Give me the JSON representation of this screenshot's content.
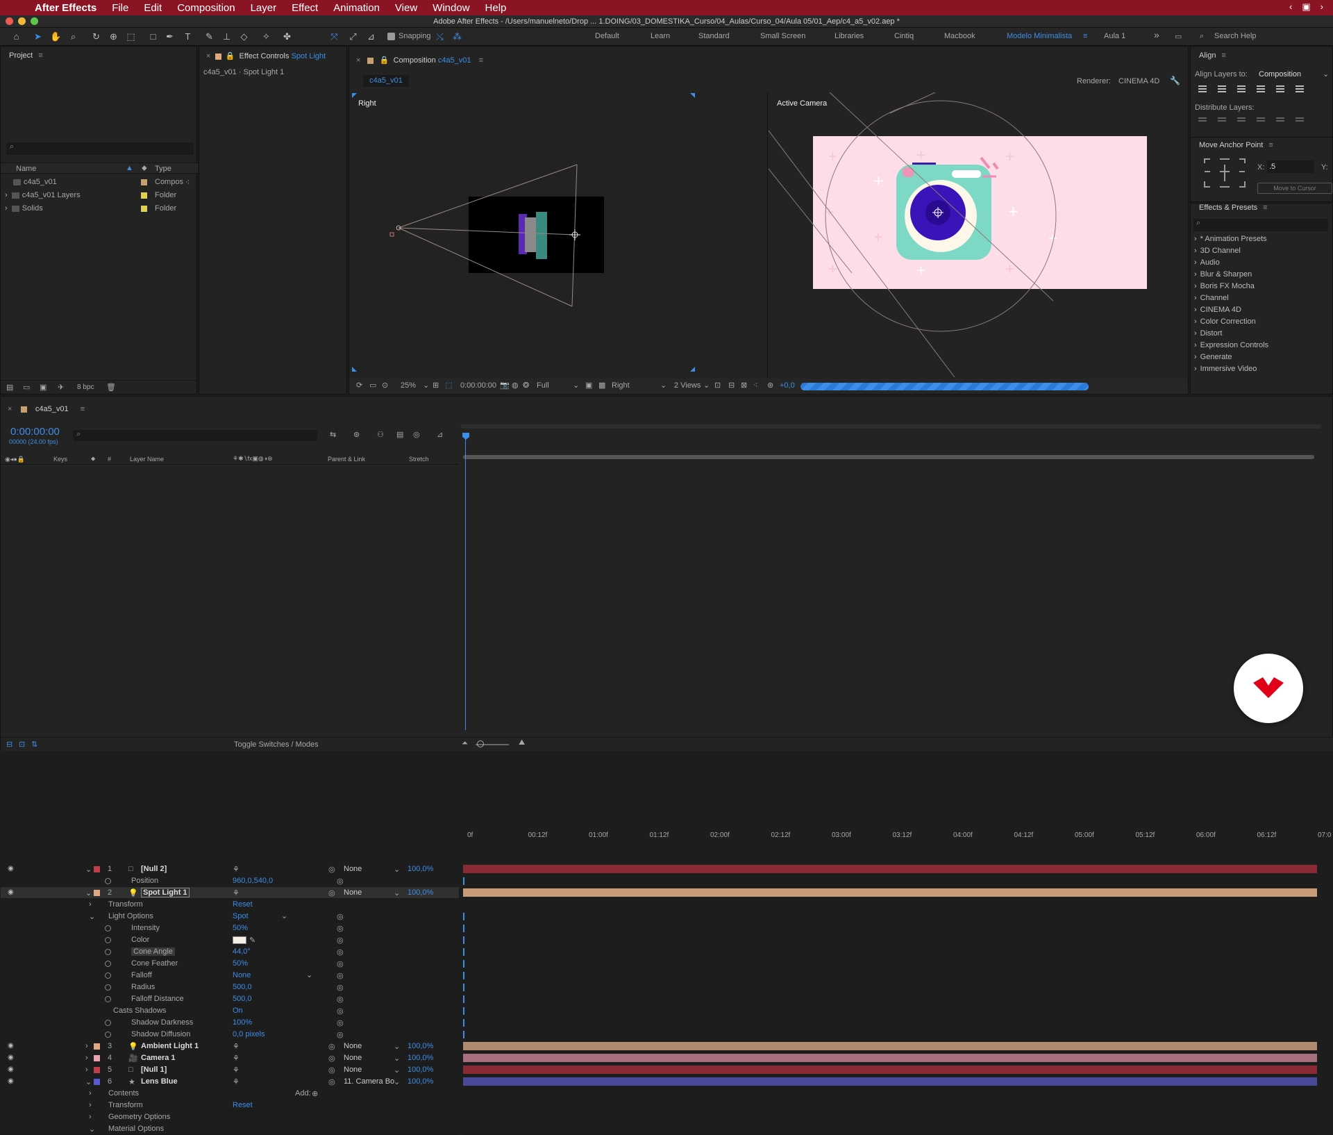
{
  "menubar": {
    "apple": "",
    "app": "After Effects",
    "items": [
      "File",
      "Edit",
      "Composition",
      "Layer",
      "Effect",
      "Animation",
      "View",
      "Window",
      "Help"
    ]
  },
  "titlebar": {
    "title": "Adobe After Effects - /Users/manuelneto/Drop ... 1.DOING/03_DOMESTIKA_Curso/04_Aulas/Curso_04/Aula 05/01_Aep/c4_a5_v02.aep *"
  },
  "toolbar": {
    "snapping": "Snapping",
    "workspaces": [
      "Default",
      "Learn",
      "Standard",
      "Small Screen",
      "Libraries",
      "Cintiq",
      "Macbook",
      "Modelo Minimalista",
      "Aula 1"
    ],
    "active_workspace": "Modelo Minimalista",
    "search_help": "Search Help"
  },
  "project": {
    "title": "Project",
    "search_placeholder": "",
    "col_name": "Name",
    "col_type": "Type",
    "items": [
      {
        "name": "c4a5_v01",
        "type": "Compos",
        "color": "#c8a070"
      },
      {
        "name": "c4a5_v01 Layers",
        "type": "Folder",
        "color": "#e0d050"
      },
      {
        "name": "Solids",
        "type": "Folder",
        "color": "#e0d050"
      }
    ],
    "bpc": "8 bpc"
  },
  "effect_controls": {
    "title": "Effect Controls",
    "layer": "Spot Light",
    "subtitle": "c4a5_v01 · Spot Light 1"
  },
  "composition": {
    "title": "Composition",
    "comp_name": "c4a5_v01",
    "tab": "c4a5_v01",
    "renderer_label": "Renderer:",
    "renderer": "CINEMA 4D",
    "view_left": "Right",
    "view_right": "Active Camera",
    "zoom": "25%",
    "timecode": "0:00:00:00",
    "resolution": "Full",
    "view_menu": "Right",
    "views": "2 Views",
    "exposure": "+0,0"
  },
  "align": {
    "title": "Align",
    "align_to_label": "Align Layers to:",
    "align_to": "Composition",
    "distribute": "Distribute Layers:"
  },
  "anchor": {
    "title": "Move Anchor Point",
    "x_label": "X:",
    "x_value": ".5",
    "y_label": "Y:",
    "move_btn": "Move to Cursor"
  },
  "effects_presets": {
    "title": "Effects & Presets",
    "items": [
      "* Animation Presets",
      "3D Channel",
      "Audio",
      "Blur & Sharpen",
      "Boris FX Mocha",
      "Channel",
      "CINEMA 4D",
      "Color Correction",
      "Distort",
      "Expression Controls",
      "Generate",
      "Immersive Video"
    ]
  },
  "timeline": {
    "comp_tab": "c4a5_v01",
    "timecode": "0:00:00:00",
    "fps": "00000 (24.00 fps)",
    "headers": {
      "keys": "Keys",
      "num": "#",
      "layer_name": "Layer Name",
      "parent": "Parent & Link",
      "stretch": "Stretch"
    },
    "ruler": [
      "0f",
      "00:12f",
      "01:00f",
      "01:12f",
      "02:00f",
      "02:12f",
      "03:00f",
      "03:12f",
      "04:00f",
      "04:12f",
      "05:00f",
      "05:12f",
      "06:00f",
      "06:12f",
      "07:0"
    ],
    "rows": [
      {
        "kind": "layer",
        "num": "1",
        "name": "[Null 2]",
        "color": "#c0404a",
        "parent": "None",
        "stretch": "100,0%",
        "bar": "#8a2a35"
      },
      {
        "kind": "prop",
        "indent": 2,
        "name": "Position",
        "value": "960,0,540,0"
      },
      {
        "kind": "layer",
        "num": "2",
        "name": "Spot Light 1",
        "color": "#e0a880",
        "parent": "None",
        "stretch": "100,0%",
        "bar": "#c79a78",
        "selected": true
      },
      {
        "kind": "group",
        "indent": 1,
        "name": "Transform",
        "value": "Reset"
      },
      {
        "kind": "group",
        "indent": 1,
        "name": "Light Options",
        "value": "Spot",
        "open": true
      },
      {
        "kind": "prop",
        "indent": 2,
        "name": "Intensity",
        "value": "50%"
      },
      {
        "kind": "prop",
        "indent": 2,
        "name": "Color",
        "value": ""
      },
      {
        "kind": "prop",
        "indent": 2,
        "name": "Cone Angle",
        "value": "44,0°",
        "highlight": true
      },
      {
        "kind": "prop",
        "indent": 2,
        "name": "Cone Feather",
        "value": "50%"
      },
      {
        "kind": "prop",
        "indent": 2,
        "name": "Falloff",
        "value": "None"
      },
      {
        "kind": "prop",
        "indent": 2,
        "name": "Radius",
        "value": "500,0"
      },
      {
        "kind": "prop",
        "indent": 2,
        "name": "Falloff Distance",
        "value": "500,0"
      },
      {
        "kind": "prop",
        "indent": 1,
        "name": "Casts Shadows",
        "value": "On",
        "nostop": true
      },
      {
        "kind": "prop",
        "indent": 2,
        "name": "Shadow Darkness",
        "value": "100%"
      },
      {
        "kind": "prop",
        "indent": 2,
        "name": "Shadow Diffusion",
        "value": "0,0 pixels"
      },
      {
        "kind": "layer",
        "num": "3",
        "name": "Ambient Light 1",
        "color": "#e0a880",
        "parent": "None",
        "stretch": "100,0%",
        "bar": "#b08a6e"
      },
      {
        "kind": "layer",
        "num": "4",
        "name": "Camera 1",
        "color": "#e8a0b0",
        "parent": "None",
        "stretch": "100,0%",
        "bar": "#a8707e"
      },
      {
        "kind": "layer",
        "num": "5",
        "name": "[Null 1]",
        "color": "#c0404a",
        "parent": "None",
        "stretch": "100,0%",
        "bar": "#8a2a35"
      },
      {
        "kind": "layer",
        "num": "6",
        "name": "Lens Blue",
        "color": "#5a5ad0",
        "parent": "11. Camera Bo",
        "stretch": "100,0%",
        "bar": "#4a4a9a"
      },
      {
        "kind": "group",
        "indent": 1,
        "name": "Contents",
        "value": "",
        "add": "Add:"
      },
      {
        "kind": "group",
        "indent": 1,
        "name": "Transform",
        "value": "Reset"
      },
      {
        "kind": "group",
        "indent": 1,
        "name": "Geometry Options",
        "value": ""
      },
      {
        "kind": "group",
        "indent": 1,
        "name": "Material Options",
        "value": "",
        "open": true
      }
    ],
    "toggle": "Toggle Switches / Modes"
  }
}
